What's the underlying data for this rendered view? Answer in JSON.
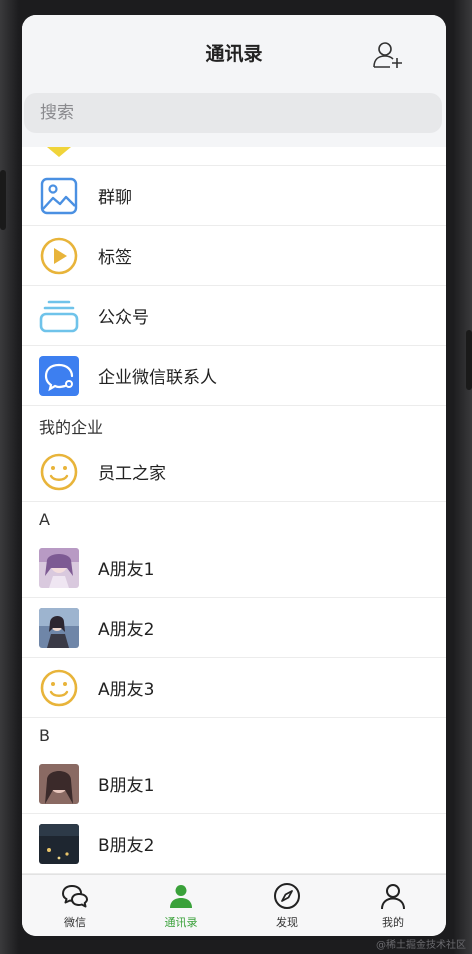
{
  "header": {
    "title": "通讯录",
    "search_placeholder": "搜索"
  },
  "functions": [
    {
      "label": "群聊",
      "icon": "image-icon"
    },
    {
      "label": "标签",
      "icon": "play-circle-icon"
    },
    {
      "label": "公众号",
      "icon": "layers-icon"
    },
    {
      "label": "企业微信联系人",
      "icon": "chat-bubble-icon"
    }
  ],
  "enterprise": {
    "section_title": "我的企业",
    "items": [
      {
        "label": "员工之家",
        "icon": "smiley-icon"
      }
    ]
  },
  "groups": [
    {
      "letter": "A",
      "contacts": [
        {
          "name": "A朋友1",
          "avatar": "anime-avatar-1"
        },
        {
          "name": "A朋友2",
          "avatar": "anime-avatar-2"
        },
        {
          "name": "A朋友3",
          "avatar": "smiley-icon"
        }
      ]
    },
    {
      "letter": "B",
      "contacts": [
        {
          "name": "B朋友1",
          "avatar": "anime-avatar-3"
        },
        {
          "name": "B朋友2",
          "avatar": "anime-avatar-4"
        }
      ]
    }
  ],
  "tabs": [
    {
      "label": "微信",
      "icon": "chat-icon",
      "active": false
    },
    {
      "label": "通讯录",
      "icon": "contacts-icon",
      "active": true
    },
    {
      "label": "发现",
      "icon": "compass-icon",
      "active": false
    },
    {
      "label": "我的",
      "icon": "person-icon",
      "active": false
    }
  ],
  "colors": {
    "accent_green": "#3aa13a",
    "icon_blue": "#4a90e2",
    "icon_yellow": "#e8b43a",
    "icon_light_blue": "#6fc3ea",
    "enterprise_blue": "#3d7ff0"
  },
  "watermark": "@稀土掘金技术社区"
}
